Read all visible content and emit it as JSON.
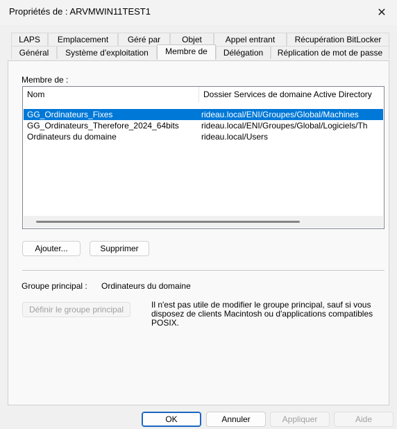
{
  "window": {
    "title": "Propriétés de : ARVMWIN11TEST1",
    "close_glyph": "✕"
  },
  "tabs_row1": [
    "LAPS",
    "Emplacement",
    "Géré par",
    "Objet",
    "Appel entrant",
    "Récupération BitLocker"
  ],
  "tabs_row2": [
    "Général",
    "Système d'exploitation",
    "Membre de",
    "Délégation",
    "Réplication de mot de passe"
  ],
  "active_tab": "Membre de",
  "member_section": {
    "label": "Membre de :",
    "columns": [
      "Nom",
      "Dossier Services de domaine Active Directory"
    ],
    "rows": [
      {
        "name": "GG_Ordinateurs_Fixes",
        "folder": "rideau.local/ENI/Groupes/Global/Machines",
        "selected": true
      },
      {
        "name": "GG_Ordinateurs_Therefore_2024_64bits",
        "folder": "rideau.local/ENI/Groupes/Global/Logiciels/Th",
        "selected": false
      },
      {
        "name": "Ordinateurs du domaine",
        "folder": "rideau.local/Users",
        "selected": false
      }
    ]
  },
  "buttons": {
    "add": "Ajouter...",
    "remove": "Supprimer",
    "set_primary": "Définir le groupe principal",
    "ok": "OK",
    "cancel": "Annuler",
    "apply": "Appliquer",
    "help": "Aide"
  },
  "primary_group": {
    "label": "Groupe principal :",
    "value": "Ordinateurs du domaine",
    "info": "Il n'est pas utile de modifier le groupe principal, sauf si vous disposez de clients Macintosh ou d'applications compatibles POSIX."
  },
  "colors": {
    "selection": "#0078d7",
    "primary_border": "#1a66c2"
  }
}
